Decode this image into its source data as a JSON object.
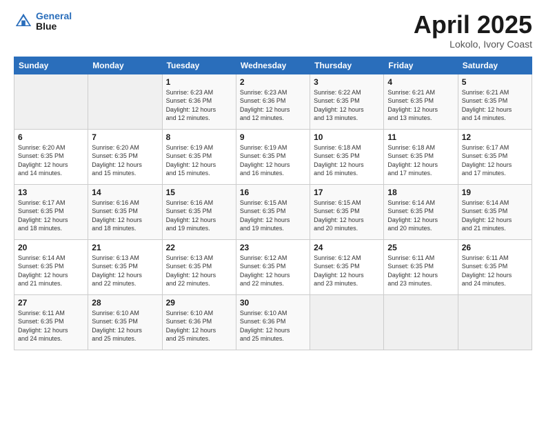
{
  "logo": {
    "line1": "General",
    "line2": "Blue"
  },
  "title": "April 2025",
  "subtitle": "Lokolo, Ivory Coast",
  "days_header": [
    "Sunday",
    "Monday",
    "Tuesday",
    "Wednesday",
    "Thursday",
    "Friday",
    "Saturday"
  ],
  "weeks": [
    [
      {
        "num": "",
        "info": ""
      },
      {
        "num": "",
        "info": ""
      },
      {
        "num": "1",
        "info": "Sunrise: 6:23 AM\nSunset: 6:36 PM\nDaylight: 12 hours\nand 12 minutes."
      },
      {
        "num": "2",
        "info": "Sunrise: 6:23 AM\nSunset: 6:36 PM\nDaylight: 12 hours\nand 12 minutes."
      },
      {
        "num": "3",
        "info": "Sunrise: 6:22 AM\nSunset: 6:35 PM\nDaylight: 12 hours\nand 13 minutes."
      },
      {
        "num": "4",
        "info": "Sunrise: 6:21 AM\nSunset: 6:35 PM\nDaylight: 12 hours\nand 13 minutes."
      },
      {
        "num": "5",
        "info": "Sunrise: 6:21 AM\nSunset: 6:35 PM\nDaylight: 12 hours\nand 14 minutes."
      }
    ],
    [
      {
        "num": "6",
        "info": "Sunrise: 6:20 AM\nSunset: 6:35 PM\nDaylight: 12 hours\nand 14 minutes."
      },
      {
        "num": "7",
        "info": "Sunrise: 6:20 AM\nSunset: 6:35 PM\nDaylight: 12 hours\nand 15 minutes."
      },
      {
        "num": "8",
        "info": "Sunrise: 6:19 AM\nSunset: 6:35 PM\nDaylight: 12 hours\nand 15 minutes."
      },
      {
        "num": "9",
        "info": "Sunrise: 6:19 AM\nSunset: 6:35 PM\nDaylight: 12 hours\nand 16 minutes."
      },
      {
        "num": "10",
        "info": "Sunrise: 6:18 AM\nSunset: 6:35 PM\nDaylight: 12 hours\nand 16 minutes."
      },
      {
        "num": "11",
        "info": "Sunrise: 6:18 AM\nSunset: 6:35 PM\nDaylight: 12 hours\nand 17 minutes."
      },
      {
        "num": "12",
        "info": "Sunrise: 6:17 AM\nSunset: 6:35 PM\nDaylight: 12 hours\nand 17 minutes."
      }
    ],
    [
      {
        "num": "13",
        "info": "Sunrise: 6:17 AM\nSunset: 6:35 PM\nDaylight: 12 hours\nand 18 minutes."
      },
      {
        "num": "14",
        "info": "Sunrise: 6:16 AM\nSunset: 6:35 PM\nDaylight: 12 hours\nand 18 minutes."
      },
      {
        "num": "15",
        "info": "Sunrise: 6:16 AM\nSunset: 6:35 PM\nDaylight: 12 hours\nand 19 minutes."
      },
      {
        "num": "16",
        "info": "Sunrise: 6:15 AM\nSunset: 6:35 PM\nDaylight: 12 hours\nand 19 minutes."
      },
      {
        "num": "17",
        "info": "Sunrise: 6:15 AM\nSunset: 6:35 PM\nDaylight: 12 hours\nand 20 minutes."
      },
      {
        "num": "18",
        "info": "Sunrise: 6:14 AM\nSunset: 6:35 PM\nDaylight: 12 hours\nand 20 minutes."
      },
      {
        "num": "19",
        "info": "Sunrise: 6:14 AM\nSunset: 6:35 PM\nDaylight: 12 hours\nand 21 minutes."
      }
    ],
    [
      {
        "num": "20",
        "info": "Sunrise: 6:14 AM\nSunset: 6:35 PM\nDaylight: 12 hours\nand 21 minutes."
      },
      {
        "num": "21",
        "info": "Sunrise: 6:13 AM\nSunset: 6:35 PM\nDaylight: 12 hours\nand 22 minutes."
      },
      {
        "num": "22",
        "info": "Sunrise: 6:13 AM\nSunset: 6:35 PM\nDaylight: 12 hours\nand 22 minutes."
      },
      {
        "num": "23",
        "info": "Sunrise: 6:12 AM\nSunset: 6:35 PM\nDaylight: 12 hours\nand 22 minutes."
      },
      {
        "num": "24",
        "info": "Sunrise: 6:12 AM\nSunset: 6:35 PM\nDaylight: 12 hours\nand 23 minutes."
      },
      {
        "num": "25",
        "info": "Sunrise: 6:11 AM\nSunset: 6:35 PM\nDaylight: 12 hours\nand 23 minutes."
      },
      {
        "num": "26",
        "info": "Sunrise: 6:11 AM\nSunset: 6:35 PM\nDaylight: 12 hours\nand 24 minutes."
      }
    ],
    [
      {
        "num": "27",
        "info": "Sunrise: 6:11 AM\nSunset: 6:35 PM\nDaylight: 12 hours\nand 24 minutes."
      },
      {
        "num": "28",
        "info": "Sunrise: 6:10 AM\nSunset: 6:35 PM\nDaylight: 12 hours\nand 25 minutes."
      },
      {
        "num": "29",
        "info": "Sunrise: 6:10 AM\nSunset: 6:36 PM\nDaylight: 12 hours\nand 25 minutes."
      },
      {
        "num": "30",
        "info": "Sunrise: 6:10 AM\nSunset: 6:36 PM\nDaylight: 12 hours\nand 25 minutes."
      },
      {
        "num": "",
        "info": ""
      },
      {
        "num": "",
        "info": ""
      },
      {
        "num": "",
        "info": ""
      }
    ]
  ]
}
